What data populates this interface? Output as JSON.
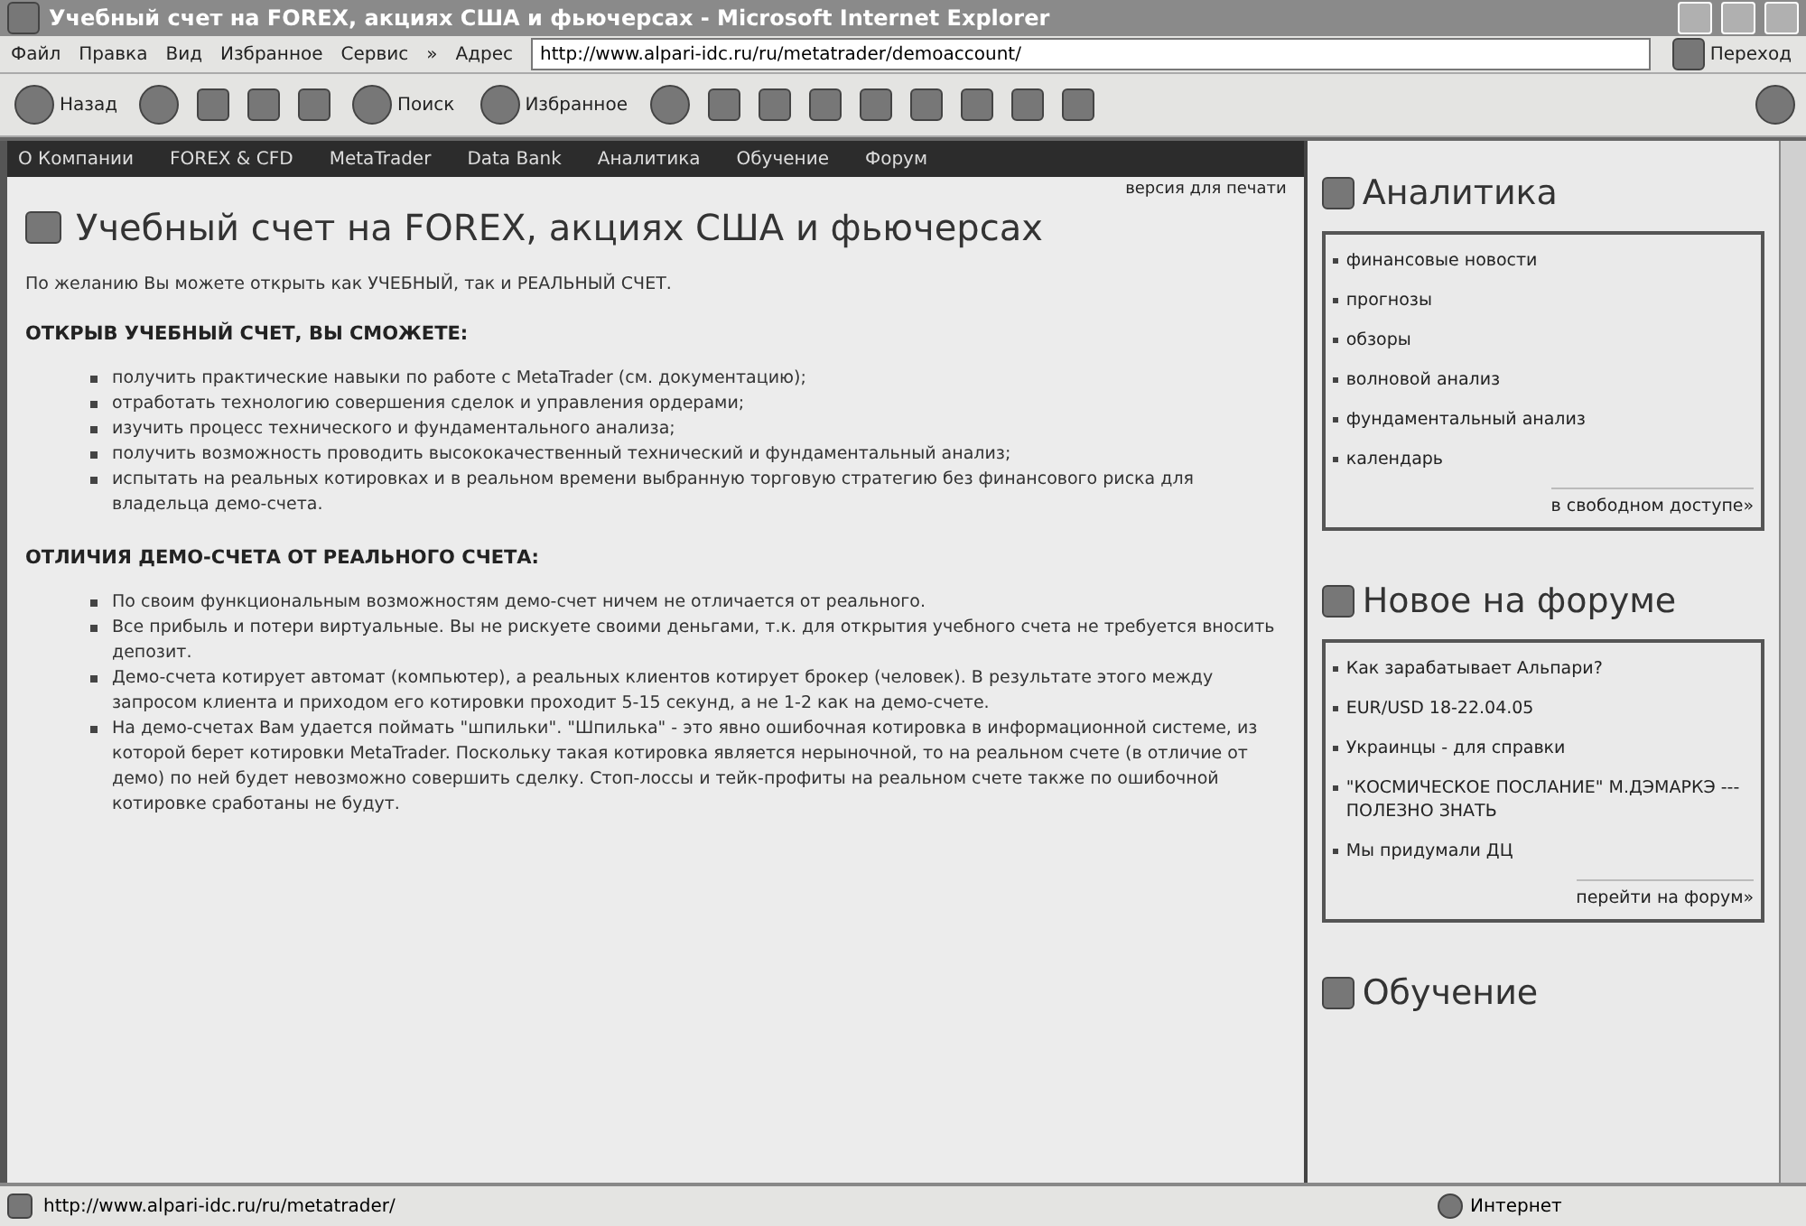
{
  "window": {
    "title": "Учебный счет на FOREX, акциях США и фьючерсах - Microsoft Internet Explorer"
  },
  "menu": [
    "Файл",
    "Правка",
    "Вид",
    "Избранное",
    "Сервис"
  ],
  "menu_chevron": "»",
  "address": {
    "label": "Адрес",
    "value": "http://www.alpari-idc.ru/ru/metatrader/demoaccount/",
    "go": "Переход"
  },
  "toolbar": {
    "back": "Назад",
    "search": "Поиск",
    "favorites": "Избранное"
  },
  "site_nav": [
    "О Компании",
    "FOREX & CFD",
    "MetaTrader",
    "Data Bank",
    "Аналитика",
    "Обучение",
    "Форум"
  ],
  "print_link": "версия для печати",
  "article": {
    "title": "Учебный счет на FOREX, акциях США и фьючерсах",
    "intro": "По желанию Вы можете открыть как УЧЕБНЫЙ, так и РЕАЛЬНЫЙ СЧЕТ.",
    "sections": [
      {
        "heading": "ОТКРЫВ УЧЕБНЫЙ СЧЕТ, ВЫ СМОЖЕТЕ:",
        "items": [
          "получить практические навыки по работе с MetaTrader (см. документацию);",
          "отработать технологию совершения сделок и управления ордерами;",
          "изучить процесс технического и фундаментального анализа;",
          "получить возможность проводить высококачественный технический и фундаментальный анализ;",
          "испытать на реальных котировках и в реальном времени выбранную торговую стратегию без финансового риска для владельца демо-счета."
        ]
      },
      {
        "heading": "ОТЛИЧИЯ ДЕМО-СЧЕТА ОТ РЕАЛЬНОГО СЧЕТА:",
        "items": [
          "По своим функциональным возможностям демо-счет ничем не отличается от реального.",
          "Все прибыль и потери виртуальные. Вы не рискуете своими деньгами, т.к. для открытия учебного счета не требуется вносить депозит.",
          "Демо-счета котирует автомат (компьютер), а реальных клиентов котирует брокер (человек). В результате этого между запросом клиента и приходом его котировки проходит 5-15 секунд, а не 1-2 как на демо-счете.",
          "На демо-счетах Вам удается поймать \"шпильки\". \"Шпилька\" - это явно ошибочная котировка в информационной системе, из которой берет котировки MetaTrader. Поскольку такая котировка является нерыночной, то на реальном счете (в отличие от демо) по ней будет невозможно совершить сделку. Стоп-лоссы и тейк-профиты на реальном счете также по ошибочной котировке сработаны не будут."
        ]
      }
    ]
  },
  "sidebar": [
    {
      "title": "Аналитика",
      "items": [
        "финансовые новости",
        "прогнозы",
        "обзоры",
        "волновой анализ",
        "фундаментальный анализ",
        "календарь"
      ],
      "footer": "в свободном доступе»"
    },
    {
      "title": "Новое на форуме",
      "items": [
        "Как зарабатывает Альпари?",
        "EUR/USD 18-22.04.05",
        "Украинцы - для справки",
        "\"КОСМИЧЕСКОЕ ПОСЛАНИЕ\" М.ДЭМАРКЭ --- ПОЛЕЗНО ЗНАТЬ",
        "Мы придумали ДЦ"
      ],
      "footer": "перейти на форум»"
    },
    {
      "title": "Обучение"
    }
  ],
  "status_bar": {
    "url": "http://www.alpari-idc.ru/ru/metatrader/",
    "zone": "Интернет"
  }
}
